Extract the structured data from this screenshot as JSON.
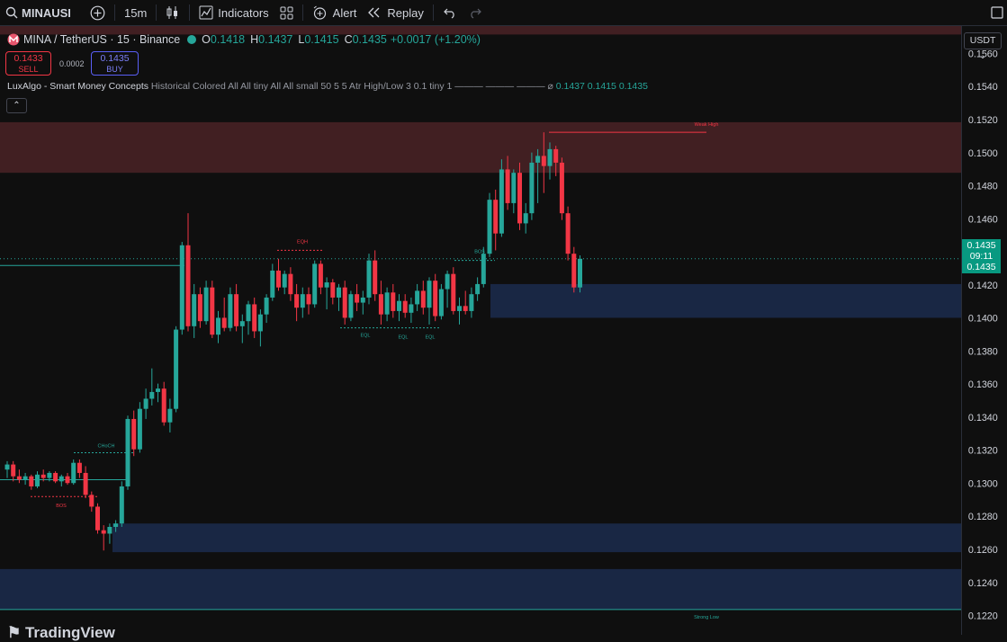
{
  "toolbar": {
    "symbol": "MINAUSI",
    "interval": "15m",
    "indicators_label": "Indicators",
    "alert_label": "Alert",
    "replay_label": "Replay"
  },
  "legend": {
    "symbol_title": "MINA / TetherUS · 15 · Binance",
    "o_label": "O",
    "o_value": "0.1418",
    "h_label": "H",
    "h_value": "0.1437",
    "l_label": "L",
    "l_value": "0.1415",
    "c_label": "C",
    "c_value": "0.1435",
    "change": "+0.0017 (+1.20%)"
  },
  "trade": {
    "sell_price": "0.1433",
    "sell_label": "SELL",
    "spread": "0.0002",
    "buy_price": "0.1435",
    "buy_label": "BUY"
  },
  "indicator": {
    "name": "LuxAlgo - Smart Money Concepts",
    "params": "Historical Colored All All tiny All All small 50 5 5 Atr High/Low 3 0.1 tiny 1 ——— ——— ——— ⌀",
    "values": "0.1437  0.1415  0.1435"
  },
  "price_axis": {
    "currency": "USDT",
    "last_price": "0.1435",
    "countdown": "09:11",
    "last_price_repeat": "0.1435"
  },
  "logo_text": "TradingView",
  "colors": {
    "up": "#26a69a",
    "down": "#f23645",
    "supply_zone": "#4a2226",
    "demand_zone": "#1b2b4d",
    "background": "#0f0f0f"
  },
  "chart_data": {
    "type": "candlestick",
    "ylim": [
      0.1212,
      0.1573
    ],
    "yticks": [
      0.122,
      0.124,
      0.126,
      0.128,
      0.13,
      0.132,
      0.134,
      0.136,
      0.138,
      0.14,
      0.142,
      0.144,
      0.146,
      0.148,
      0.15,
      0.152,
      0.154,
      0.156
    ],
    "grid": false,
    "candles": [
      {
        "o": 0.131,
        "h": 0.1315,
        "l": 0.1305,
        "c": 0.1313
      },
      {
        "o": 0.1313,
        "h": 0.1315,
        "l": 0.1303,
        "c": 0.1306
      },
      {
        "o": 0.1306,
        "h": 0.131,
        "l": 0.1302,
        "c": 0.1304
      },
      {
        "o": 0.1304,
        "h": 0.1308,
        "l": 0.1301,
        "c": 0.1306
      },
      {
        "o": 0.1306,
        "h": 0.1307,
        "l": 0.1298,
        "c": 0.13
      },
      {
        "o": 0.13,
        "h": 0.1309,
        "l": 0.1299,
        "c": 0.1307
      },
      {
        "o": 0.1307,
        "h": 0.131,
        "l": 0.1303,
        "c": 0.1305
      },
      {
        "o": 0.1305,
        "h": 0.1309,
        "l": 0.1303,
        "c": 0.1308
      },
      {
        "o": 0.1308,
        "h": 0.1309,
        "l": 0.1302,
        "c": 0.1303
      },
      {
        "o": 0.1303,
        "h": 0.1307,
        "l": 0.13,
        "c": 0.1306
      },
      {
        "o": 0.1306,
        "h": 0.1308,
        "l": 0.1301,
        "c": 0.1302
      },
      {
        "o": 0.1302,
        "h": 0.1316,
        "l": 0.1301,
        "c": 0.1314
      },
      {
        "o": 0.1314,
        "h": 0.1316,
        "l": 0.1305,
        "c": 0.1308
      },
      {
        "o": 0.1308,
        "h": 0.1312,
        "l": 0.1293,
        "c": 0.1295
      },
      {
        "o": 0.1295,
        "h": 0.1297,
        "l": 0.1285,
        "c": 0.1288
      },
      {
        "o": 0.1288,
        "h": 0.129,
        "l": 0.1272,
        "c": 0.1274
      },
      {
        "o": 0.1274,
        "h": 0.1277,
        "l": 0.1262,
        "c": 0.1272
      },
      {
        "o": 0.1272,
        "h": 0.1278,
        "l": 0.1266,
        "c": 0.1276
      },
      {
        "o": 0.1276,
        "h": 0.128,
        "l": 0.1273,
        "c": 0.1278
      },
      {
        "o": 0.1278,
        "h": 0.1303,
        "l": 0.1276,
        "c": 0.13
      },
      {
        "o": 0.13,
        "h": 0.1342,
        "l": 0.1298,
        "c": 0.134
      },
      {
        "o": 0.134,
        "h": 0.1345,
        "l": 0.1318,
        "c": 0.1322
      },
      {
        "o": 0.1322,
        "h": 0.135,
        "l": 0.132,
        "c": 0.1346
      },
      {
        "o": 0.1346,
        "h": 0.1358,
        "l": 0.134,
        "c": 0.1352
      },
      {
        "o": 0.1352,
        "h": 0.137,
        "l": 0.1348,
        "c": 0.1356
      },
      {
        "o": 0.1356,
        "h": 0.1361,
        "l": 0.135,
        "c": 0.1358
      },
      {
        "o": 0.1358,
        "h": 0.1362,
        "l": 0.1336,
        "c": 0.1338
      },
      {
        "o": 0.1338,
        "h": 0.1352,
        "l": 0.1332,
        "c": 0.1346
      },
      {
        "o": 0.1346,
        "h": 0.1395,
        "l": 0.1344,
        "c": 0.1393
      },
      {
        "o": 0.1393,
        "h": 0.1445,
        "l": 0.139,
        "c": 0.1443
      },
      {
        "o": 0.1443,
        "h": 0.1462,
        "l": 0.1392,
        "c": 0.1395
      },
      {
        "o": 0.1395,
        "h": 0.142,
        "l": 0.1388,
        "c": 0.1414
      },
      {
        "o": 0.1414,
        "h": 0.1418,
        "l": 0.1394,
        "c": 0.1398
      },
      {
        "o": 0.1398,
        "h": 0.1422,
        "l": 0.1396,
        "c": 0.1418
      },
      {
        "o": 0.1418,
        "h": 0.1422,
        "l": 0.1388,
        "c": 0.139
      },
      {
        "o": 0.139,
        "h": 0.1404,
        "l": 0.1385,
        "c": 0.14
      },
      {
        "o": 0.14,
        "h": 0.1412,
        "l": 0.1392,
        "c": 0.1394
      },
      {
        "o": 0.1394,
        "h": 0.1418,
        "l": 0.1392,
        "c": 0.1414
      },
      {
        "o": 0.1414,
        "h": 0.142,
        "l": 0.1392,
        "c": 0.1395
      },
      {
        "o": 0.1395,
        "h": 0.1402,
        "l": 0.1385,
        "c": 0.1398
      },
      {
        "o": 0.1398,
        "h": 0.141,
        "l": 0.139,
        "c": 0.1408
      },
      {
        "o": 0.1408,
        "h": 0.1412,
        "l": 0.1388,
        "c": 0.1392
      },
      {
        "o": 0.1392,
        "h": 0.1405,
        "l": 0.1383,
        "c": 0.1402
      },
      {
        "o": 0.1402,
        "h": 0.1414,
        "l": 0.1397,
        "c": 0.1412
      },
      {
        "o": 0.1412,
        "h": 0.1432,
        "l": 0.141,
        "c": 0.1428
      },
      {
        "o": 0.1428,
        "h": 0.1435,
        "l": 0.1416,
        "c": 0.1418
      },
      {
        "o": 0.1418,
        "h": 0.1428,
        "l": 0.1414,
        "c": 0.1426
      },
      {
        "o": 0.1426,
        "h": 0.143,
        "l": 0.141,
        "c": 0.1414
      },
      {
        "o": 0.1414,
        "h": 0.142,
        "l": 0.1398,
        "c": 0.1406
      },
      {
        "o": 0.1406,
        "h": 0.1418,
        "l": 0.14,
        "c": 0.1414
      },
      {
        "o": 0.1414,
        "h": 0.1418,
        "l": 0.1402,
        "c": 0.1408
      },
      {
        "o": 0.1408,
        "h": 0.1434,
        "l": 0.1406,
        "c": 0.1432
      },
      {
        "o": 0.1432,
        "h": 0.1434,
        "l": 0.1414,
        "c": 0.1418
      },
      {
        "o": 0.1418,
        "h": 0.1424,
        "l": 0.1405,
        "c": 0.1421
      },
      {
        "o": 0.1421,
        "h": 0.1423,
        "l": 0.1408,
        "c": 0.1412
      },
      {
        "o": 0.1412,
        "h": 0.142,
        "l": 0.1404,
        "c": 0.1418
      },
      {
        "o": 0.1418,
        "h": 0.1422,
        "l": 0.1396,
        "c": 0.14
      },
      {
        "o": 0.14,
        "h": 0.1416,
        "l": 0.1398,
        "c": 0.1414
      },
      {
        "o": 0.1414,
        "h": 0.142,
        "l": 0.1404,
        "c": 0.1409
      },
      {
        "o": 0.1409,
        "h": 0.1416,
        "l": 0.1402,
        "c": 0.1412
      },
      {
        "o": 0.1412,
        "h": 0.1438,
        "l": 0.1408,
        "c": 0.1434
      },
      {
        "o": 0.1434,
        "h": 0.144,
        "l": 0.141,
        "c": 0.1414
      },
      {
        "o": 0.1414,
        "h": 0.1422,
        "l": 0.1396,
        "c": 0.1402
      },
      {
        "o": 0.1402,
        "h": 0.1418,
        "l": 0.1398,
        "c": 0.1415
      },
      {
        "o": 0.1415,
        "h": 0.142,
        "l": 0.14,
        "c": 0.1404
      },
      {
        "o": 0.1404,
        "h": 0.1414,
        "l": 0.1398,
        "c": 0.141
      },
      {
        "o": 0.141,
        "h": 0.1414,
        "l": 0.14,
        "c": 0.1403
      },
      {
        "o": 0.1403,
        "h": 0.1412,
        "l": 0.1397,
        "c": 0.1408
      },
      {
        "o": 0.1408,
        "h": 0.142,
        "l": 0.1404,
        "c": 0.1416
      },
      {
        "o": 0.1416,
        "h": 0.1422,
        "l": 0.1402,
        "c": 0.1406
      },
      {
        "o": 0.1406,
        "h": 0.1424,
        "l": 0.1396,
        "c": 0.1422
      },
      {
        "o": 0.1422,
        "h": 0.1426,
        "l": 0.1398,
        "c": 0.1401
      },
      {
        "o": 0.1401,
        "h": 0.142,
        "l": 0.1399,
        "c": 0.1417
      },
      {
        "o": 0.1417,
        "h": 0.1428,
        "l": 0.1406,
        "c": 0.1426
      },
      {
        "o": 0.1426,
        "h": 0.143,
        "l": 0.1402,
        "c": 0.1404
      },
      {
        "o": 0.1404,
        "h": 0.1412,
        "l": 0.1396,
        "c": 0.1407
      },
      {
        "o": 0.1407,
        "h": 0.1416,
        "l": 0.1402,
        "c": 0.1404
      },
      {
        "o": 0.1404,
        "h": 0.1418,
        "l": 0.14,
        "c": 0.1414
      },
      {
        "o": 0.1414,
        "h": 0.1424,
        "l": 0.141,
        "c": 0.142
      },
      {
        "o": 0.142,
        "h": 0.1442,
        "l": 0.1418,
        "c": 0.1438
      },
      {
        "o": 0.1438,
        "h": 0.1474,
        "l": 0.1436,
        "c": 0.147
      },
      {
        "o": 0.147,
        "h": 0.1476,
        "l": 0.144,
        "c": 0.145
      },
      {
        "o": 0.145,
        "h": 0.1494,
        "l": 0.1448,
        "c": 0.1488
      },
      {
        "o": 0.1488,
        "h": 0.1496,
        "l": 0.1464,
        "c": 0.1468
      },
      {
        "o": 0.1468,
        "h": 0.1488,
        "l": 0.1462,
        "c": 0.1486
      },
      {
        "o": 0.1486,
        "h": 0.1492,
        "l": 0.1452,
        "c": 0.1456
      },
      {
        "o": 0.1456,
        "h": 0.1468,
        "l": 0.145,
        "c": 0.1462
      },
      {
        "o": 0.1462,
        "h": 0.1498,
        "l": 0.1458,
        "c": 0.1492
      },
      {
        "o": 0.1492,
        "h": 0.15,
        "l": 0.1468,
        "c": 0.1496
      },
      {
        "o": 0.1496,
        "h": 0.151,
        "l": 0.1474,
        "c": 0.149
      },
      {
        "o": 0.149,
        "h": 0.1504,
        "l": 0.1482,
        "c": 0.15
      },
      {
        "o": 0.15,
        "h": 0.1502,
        "l": 0.1484,
        "c": 0.1492
      },
      {
        "o": 0.1492,
        "h": 0.1495,
        "l": 0.1458,
        "c": 0.1462
      },
      {
        "o": 0.1462,
        "h": 0.1466,
        "l": 0.1434,
        "c": 0.1438
      },
      {
        "o": 0.1438,
        "h": 0.1442,
        "l": 0.1415,
        "c": 0.1418
      },
      {
        "o": 0.1418,
        "h": 0.1437,
        "l": 0.1415,
        "c": 0.1435
      }
    ],
    "zones": [
      {
        "kind": "supply",
        "from": 0.1568,
        "to": 0.16
      },
      {
        "kind": "supply",
        "from": 0.1486,
        "to": 0.1516
      },
      {
        "kind": "demand",
        "from": 0.14,
        "to": 0.142
      },
      {
        "kind": "demand",
        "from": 0.1261,
        "to": 0.1278
      },
      {
        "kind": "demand",
        "from": 0.1227,
        "to": 0.1251
      }
    ],
    "labels": [
      {
        "text": "CHoCH",
        "price": 0.132
      },
      {
        "text": "BOS",
        "price": 0.1294
      },
      {
        "text": "EQH",
        "price": 0.144
      },
      {
        "text": "EQL",
        "price": 0.1394
      },
      {
        "text": "EQL",
        "price": 0.1394
      },
      {
        "text": "EQL",
        "price": 0.1394
      },
      {
        "text": "BOS",
        "price": 0.1434
      },
      {
        "text": "Weak High",
        "price": 0.151
      },
      {
        "text": "Strong Low",
        "price": 0.1227
      }
    ],
    "last_price": 0.1435
  }
}
